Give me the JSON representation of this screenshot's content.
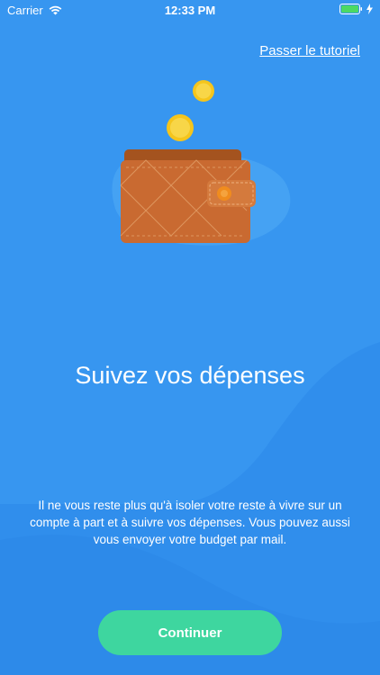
{
  "status_bar": {
    "carrier": "Carrier",
    "time": "12:33 PM",
    "wifi_icon": "wifi-icon",
    "battery_icon": "battery-icon",
    "charging_icon": "charging-bolt-icon"
  },
  "header": {
    "skip_label": "Passer le tutoriel"
  },
  "illustration": {
    "icon": "wallet-with-coins-illustration"
  },
  "main": {
    "title": "Suivez vos dépenses",
    "description": "Il ne vous reste plus qu'à isoler votre reste à vivre sur un compte à part et à suivre vos dépenses. Vous pouvez aussi vous envoyer votre budget par mail."
  },
  "footer": {
    "continue_label": "Continuer"
  },
  "colors": {
    "background": "#3796f0",
    "wave_light": "#4aa6f3",
    "wave_dark": "#2d86ea",
    "button": "#3ed69f",
    "wallet": "#c96a31",
    "coin": "#f5c51c"
  }
}
